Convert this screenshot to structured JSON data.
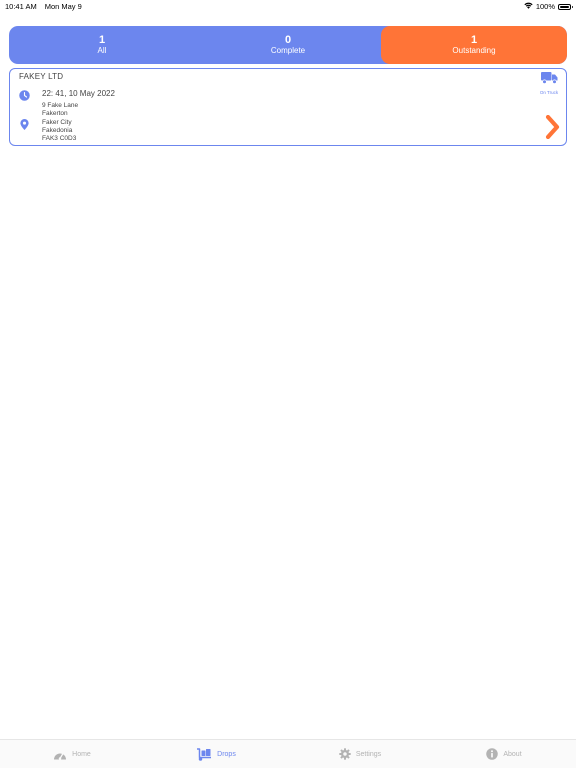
{
  "status_bar": {
    "time": "10:41 AM",
    "date": "Mon May 9",
    "battery": "100%"
  },
  "filters": [
    {
      "count": "1",
      "label": "All",
      "active": false
    },
    {
      "count": "0",
      "label": "Complete",
      "active": false
    },
    {
      "count": "1",
      "label": "Outstanding",
      "active": true
    }
  ],
  "drop": {
    "company": "FAKEY LTD",
    "status_label": "On Truck",
    "datetime": "22: 41, 10 May 2022",
    "address": [
      "9 Fake Lane",
      "Fakerton",
      "Faker City",
      "Fakedonia",
      "FAK3 C0D3"
    ]
  },
  "tabs": [
    {
      "label": "Home",
      "icon": "gauge-icon",
      "active": false
    },
    {
      "label": "Drops",
      "icon": "dolly-icon",
      "active": true
    },
    {
      "label": "Settings",
      "icon": "gear-icon",
      "active": false
    },
    {
      "label": "About",
      "icon": "info-icon",
      "active": false
    }
  ],
  "colors": {
    "primary": "#6c86ee",
    "accent": "#ff7437",
    "tab_inactive": "#b3b3b3"
  }
}
